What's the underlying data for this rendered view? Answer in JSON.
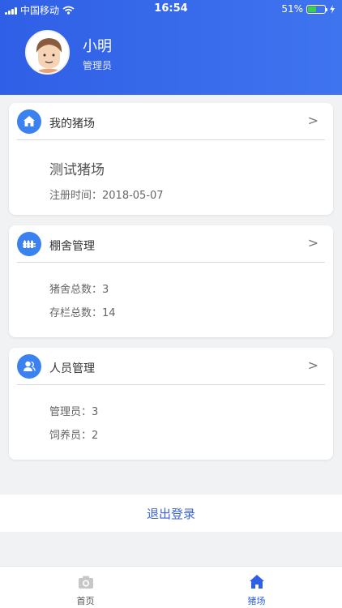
{
  "status": {
    "carrier": "中国移动",
    "time": "16:54",
    "battery_percent": "51%",
    "battery_level": 0.51
  },
  "profile": {
    "name": "小明",
    "role": "管理员",
    "avatar_icon": "user-avatar-icon"
  },
  "cards": {
    "farm": {
      "title": "我的猪场",
      "icon": "home-icon",
      "farm_name": "测试猪场",
      "register_label": "注册时间：",
      "register_date": "2018-05-07"
    },
    "pens": {
      "title": "棚舍管理",
      "icon": "fence-icon",
      "total_label": "猪舍总数：",
      "total_value": "3",
      "stock_label": "存栏总数：",
      "stock_value": "14"
    },
    "staff": {
      "title": "人员管理",
      "icon": "people-icon",
      "admin_label": "管理员：",
      "admin_value": "3",
      "feeder_label": "饲养员：",
      "feeder_value": "2"
    }
  },
  "actions": {
    "logout": "退出登录"
  },
  "nav": {
    "home": "首页",
    "farm": "猪场"
  },
  "colors": {
    "accent": "#2f5fe6",
    "icon_circle": "#3b82f0",
    "logout": "#3e63d8"
  }
}
